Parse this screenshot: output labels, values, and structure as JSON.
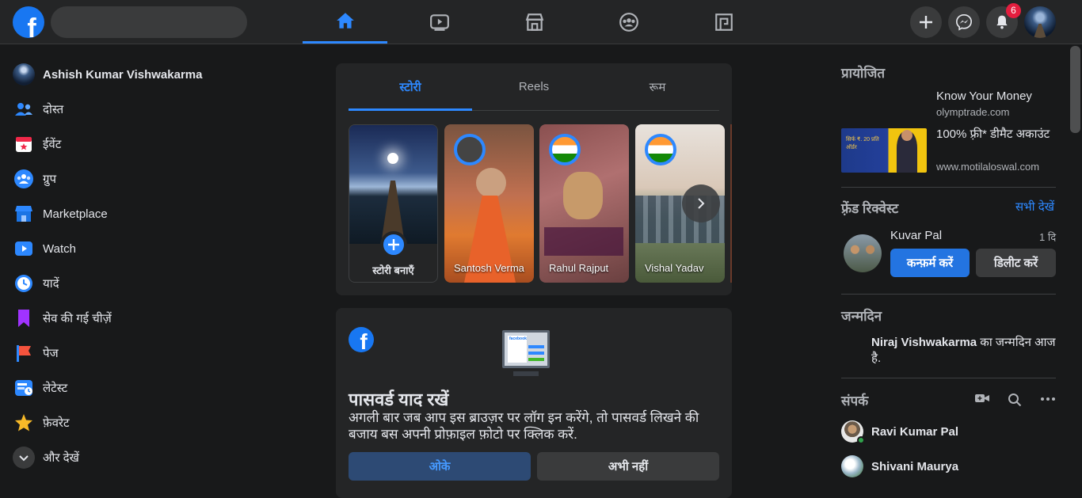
{
  "topbar": {
    "logo_letter": "f",
    "search_placeholder": "",
    "nav": [
      "home",
      "watch",
      "marketplace",
      "groups",
      "gaming"
    ],
    "notifications_count": "6"
  },
  "left_nav": {
    "items": [
      {
        "label": "Ashish Kumar Vishwakarma",
        "icon": "profile-avatar"
      },
      {
        "label": "दोस्त",
        "icon": "friends-icon"
      },
      {
        "label": "ईवेंट",
        "icon": "events-icon"
      },
      {
        "label": "ग्रुप",
        "icon": "groups-icon"
      },
      {
        "label": "Marketplace",
        "icon": "marketplace-icon"
      },
      {
        "label": "Watch",
        "icon": "watch-icon"
      },
      {
        "label": "यादें",
        "icon": "memories-icon"
      },
      {
        "label": "सेव की गई चीज़ें",
        "icon": "saved-icon"
      },
      {
        "label": "पेज",
        "icon": "pages-icon"
      },
      {
        "label": "लेटेस्ट",
        "icon": "latest-icon"
      },
      {
        "label": "फ़ेवरेट",
        "icon": "favorites-icon"
      },
      {
        "label": "और देखें",
        "icon": "chevron-down-icon"
      }
    ]
  },
  "stories": {
    "tabs": [
      "स्टोरी",
      "Reels",
      "रूम"
    ],
    "create_label": "स्टोरी बनाएँ",
    "items": [
      {
        "name": "Santosh Verma"
      },
      {
        "name": "Rahul Rajput"
      },
      {
        "name": "Vishal Yadav"
      }
    ]
  },
  "password_prompt": {
    "title": "पासवर्ड याद रखें",
    "description": "अगली बार जब आप इस ब्राउज़र पर लॉग इन करेंगे, तो पासवर्ड लिखने की बजाय बस अपनी प्रोफ़ाइल फ़ोटो पर क्लिक करें.",
    "ok_label": "ओके",
    "not_now_label": "अभी नहीं",
    "image_logo_text": "facebook"
  },
  "sponsored": {
    "heading": "प्रायोजित",
    "ads": [
      {
        "title": "Know Your Money",
        "domain": "olymptrade.com"
      },
      {
        "title": "100% फ़्री* डीमैट अकाउंट",
        "domain": "www.motilaloswal.com",
        "banner_text": "सिर्फ ₹. 20 प्रति ऑर्डर"
      }
    ]
  },
  "friend_requests": {
    "heading": "फ़्रेंड रिक्वेस्ट",
    "see_all": "सभी देखें",
    "request": {
      "name": "Kuvar Pal",
      "time": "1 दि",
      "confirm": "कन्फ़र्म करें",
      "delete": "डिलीट करें"
    }
  },
  "birthdays": {
    "heading": "जन्मदिन",
    "name": "Niraj Vishwakarma",
    "text": " का जन्मदिन आज है."
  },
  "contacts": {
    "heading": "संपर्क",
    "items": [
      {
        "name": "Ravi Kumar Pal"
      },
      {
        "name": "Shivani Maurya"
      }
    ]
  },
  "colors": {
    "accent": "#2d88ff",
    "badge": "#e41e3f",
    "surface": "#242526",
    "background": "#18191a"
  }
}
